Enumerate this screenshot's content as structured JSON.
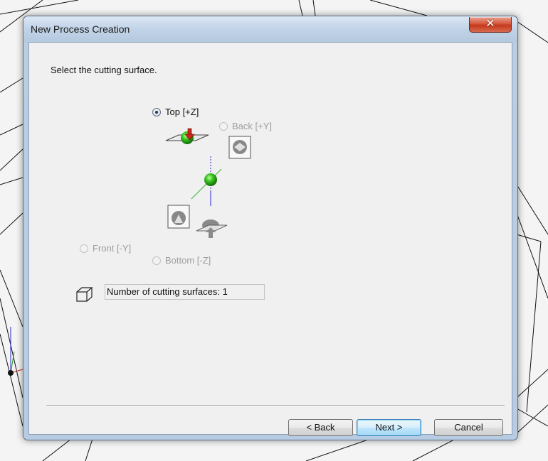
{
  "window": {
    "title": "New Process Creation",
    "close_symbol": "✕"
  },
  "instruction": "Select the cutting surface.",
  "surfaces": [
    {
      "label": "Top [+Z]",
      "selected": true,
      "enabled": true
    },
    {
      "label": "Back [+Y]",
      "selected": false,
      "enabled": false
    },
    {
      "label": "Front [-Y]",
      "selected": false,
      "enabled": false
    },
    {
      "label": "Bottom [-Z]",
      "selected": false,
      "enabled": false
    }
  ],
  "cutting_surfaces_field": "Number of cutting surfaces: 1",
  "buttons": {
    "back": "< Back",
    "next": "Next >",
    "cancel": "Cancel"
  },
  "icons": {
    "orientation_sphere": "green-sphere-icon",
    "cut_arrow": "red-down-arrow-icon",
    "box": "box-outline-icon"
  },
  "colors": {
    "sphere": "#36c21d",
    "arrow": "#c8281c",
    "accent": "#3c7fb1"
  }
}
